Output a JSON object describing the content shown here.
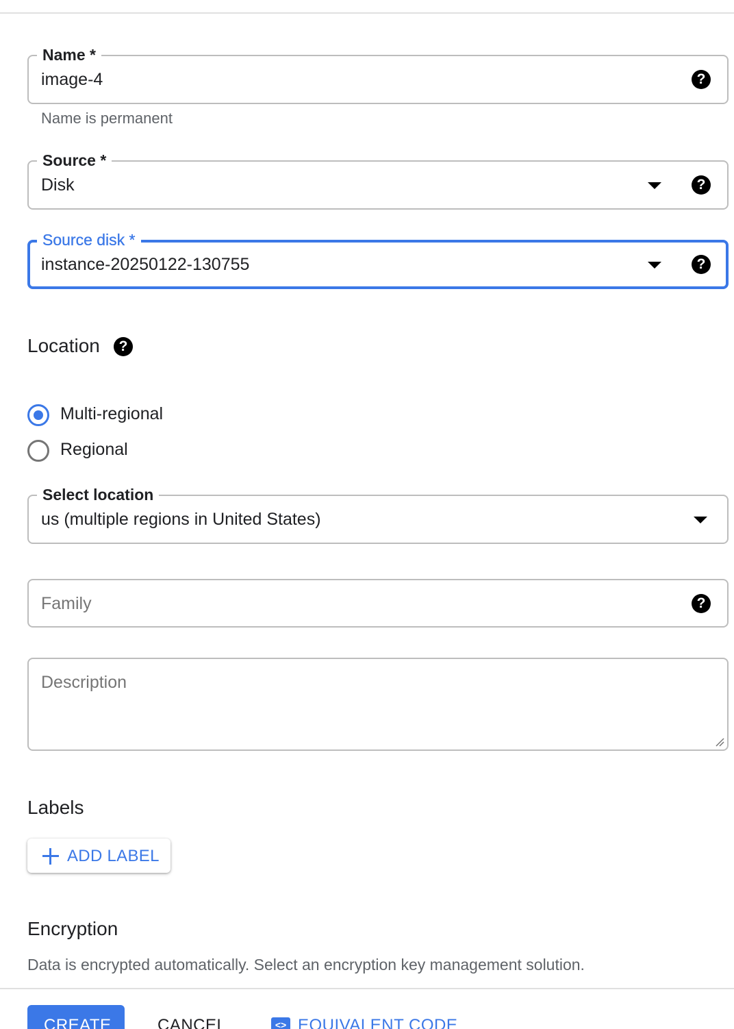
{
  "form": {
    "name": {
      "label": "Name *",
      "value": "image-4",
      "hint": "Name is permanent"
    },
    "source": {
      "label": "Source *",
      "value": "Disk"
    },
    "source_disk": {
      "label": "Source disk *",
      "value": "instance-20250122-130755"
    },
    "location": {
      "title": "Location",
      "options": [
        {
          "label": "Multi-regional",
          "checked": true
        },
        {
          "label": "Regional",
          "checked": false
        }
      ],
      "select": {
        "label": "Select location",
        "value": "us (multiple regions in United States)"
      }
    },
    "family": {
      "placeholder": "Family"
    },
    "description": {
      "placeholder": "Description"
    },
    "labels": {
      "title": "Labels",
      "add_button": "ADD LABEL"
    },
    "encryption": {
      "title": "Encryption",
      "description": "Data is encrypted automatically. Select an encryption key management solution."
    }
  },
  "actions": {
    "create": "CREATE",
    "cancel": "CANCEL",
    "equivalent_code": "EQUIVALENT CODE"
  },
  "icons": {
    "help": "help-icon",
    "dropdown": "caret-down-icon",
    "add": "plus-icon",
    "code": "code-icon"
  },
  "colors": {
    "accent": "#3b78e7",
    "border": "#bdbdbd",
    "text": "#202124",
    "secondary_text": "#5f6368"
  }
}
